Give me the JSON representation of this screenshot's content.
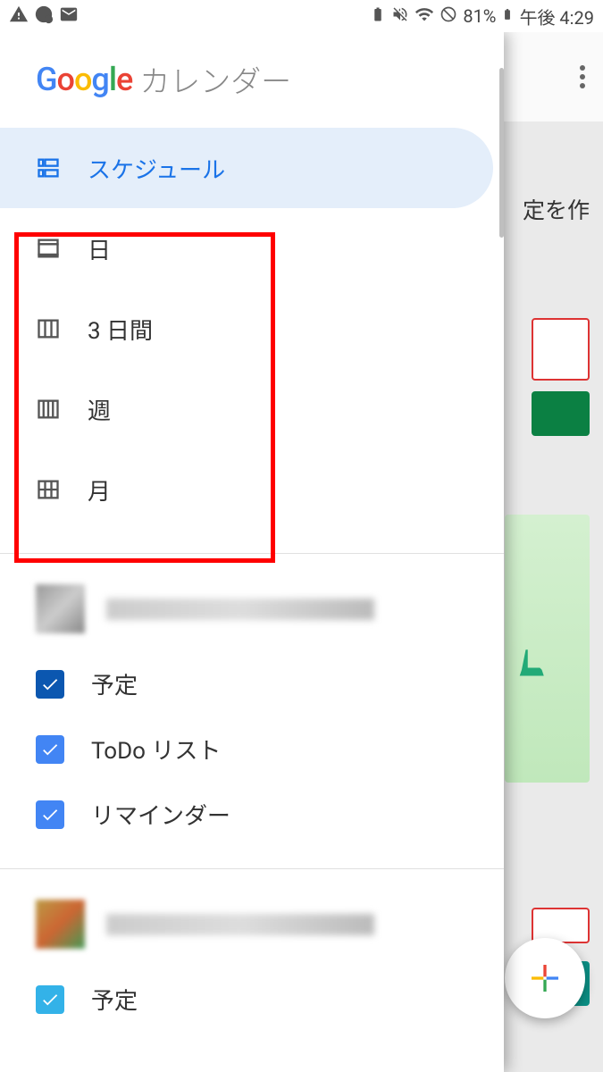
{
  "statusbar": {
    "battery_percent": "81%",
    "time": "午後 4:29"
  },
  "drawer": {
    "app_name": "カレンダー",
    "views": {
      "schedule": "スケジュール",
      "day": "日",
      "three_day": "3 日間",
      "week": "週",
      "month": "月"
    },
    "calendars": {
      "account1": {
        "items": [
          {
            "label": "予定",
            "color": "#0b57b0"
          },
          {
            "label": "ToDo リスト",
            "color": "#4285f4"
          },
          {
            "label": "リマインダー",
            "color": "#4285f4"
          }
        ]
      },
      "account2": {
        "items": [
          {
            "label": "予定",
            "color": "#33b2e8"
          }
        ]
      }
    }
  },
  "background": {
    "peek_text": "定を作"
  }
}
